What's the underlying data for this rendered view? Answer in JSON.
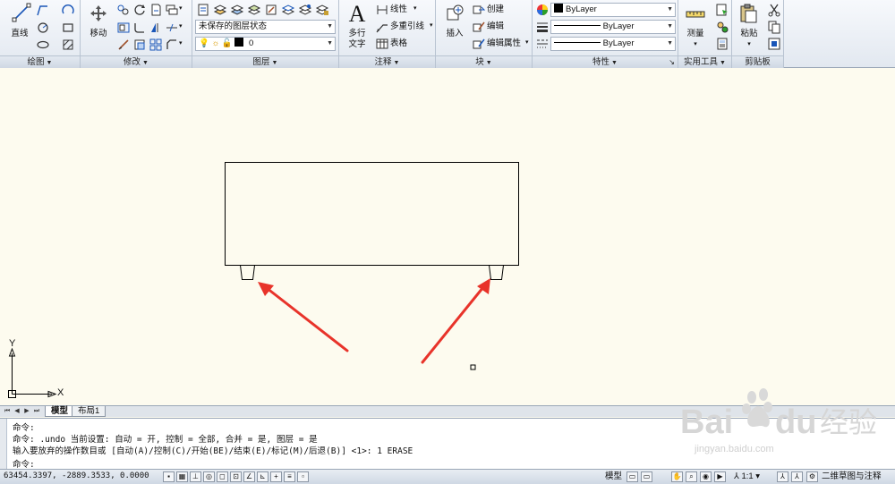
{
  "ribbon": {
    "panels": {
      "draw": "绘图",
      "modify": "修改",
      "layer": "图层",
      "annotation": "注释",
      "block": "块",
      "properties": "特性",
      "utilities": "实用工具",
      "clipboard": "剪贴板"
    },
    "draw": {
      "line": "直线"
    },
    "modify": {
      "move": "移动"
    },
    "layer": {
      "state": "未保存的图层状态",
      "current": "0"
    },
    "annotation": {
      "mtext_1": "多行",
      "mtext_2": "文字",
      "linear": "线性",
      "mleader": "多重引线",
      "table": "表格"
    },
    "block": {
      "insert": "插入",
      "create": "创建",
      "edit": "编辑",
      "edit_attr": "编辑属性"
    },
    "properties": {
      "color": "ByLayer",
      "linetype": "ByLayer",
      "lineweight": "ByLayer"
    },
    "utilities": {
      "measure": "测量"
    },
    "clipboard": {
      "paste": "粘贴"
    }
  },
  "canvas": {
    "ucs_x": "X",
    "ucs_y": "Y"
  },
  "layout_tabs": [
    "模型",
    "布局1"
  ],
  "command": {
    "lines": [
      "命令:",
      "命令:  .undo 当前设置: 自动 = 开, 控制 = 全部, 合并 = 是, 图层 = 是",
      "输入要放弃的操作数目或 [自动(A)/控制(C)/开始(BE)/结束(E)/标记(M)/后退(B)] <1>: 1 ERASE",
      "命令:"
    ]
  },
  "status": {
    "coords": "63454.3397, -2889.3533, 0.0000",
    "model": "模型",
    "scale": "1:1",
    "workspace": "二维草图与注释"
  },
  "watermark": {
    "brand_latin_1": "Bai",
    "brand_latin_2": "du",
    "brand_cn": "经验",
    "url": "jingyan.baidu.com"
  },
  "colors": {
    "canvas_bg": "#fdfbef",
    "arrow": "#e8332a",
    "ribbon_bg": "#e2e8f0"
  }
}
